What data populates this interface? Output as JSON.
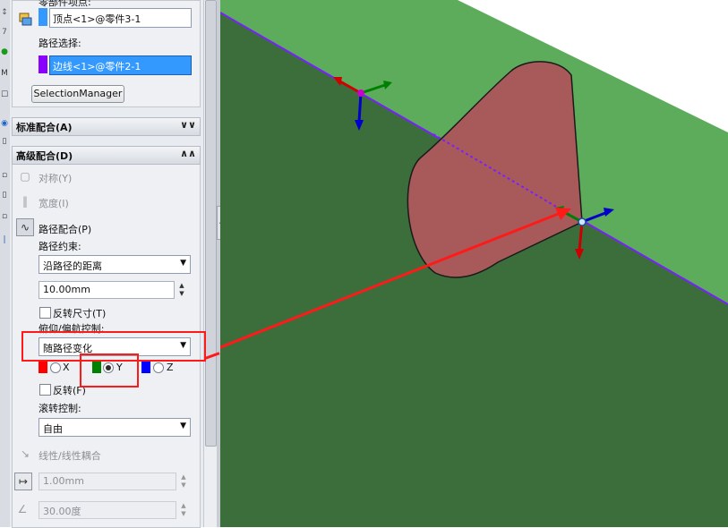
{
  "panel": {
    "top_label_partial": "零部件项点:",
    "component_value": "顶点<1>@零件3-1",
    "path_label": "路径选择:",
    "path_value": "边线<1>@零件2-1",
    "selection_manager": "SelectionManager",
    "standard_mates": "标准配合(A)",
    "advanced_mates": "高级配合(D)",
    "mates": {
      "symmetric": "对称(Y)",
      "width": "宽度(I)",
      "path_mate": "路径配合(P)"
    },
    "path_constraint_label": "路径约束:",
    "path_constraint_value": "沿路径的距离",
    "distance_value": "10.00mm",
    "flip_dimension": "反转尺寸(T)",
    "pitch_yaw_label": "俯仰/偏航控制:",
    "pitch_yaw_value": "随路径变化",
    "axes": {
      "x": "X",
      "y": "Y",
      "z": "Z",
      "selected": "Y"
    },
    "flip": "反转(F)",
    "roll_label": "滚转控制:",
    "roll_value": "自由",
    "linear_coupler": "线性/线性耦合",
    "linear_value": "1.00mm",
    "angle_value": "30.00度"
  },
  "colors": {
    "x_axis": "#ff0000",
    "y_axis": "#008000",
    "z_axis": "#0000ff",
    "path_swatch": "#8a00ff",
    "component_swatch": "#3399ff",
    "plane_light": "#5cac5c",
    "plane_dark": "#3b6e3b",
    "cone": "#a85a5a",
    "edge_line": "#7a1fff",
    "annotation": "#ff0000"
  },
  "icons": {
    "component": "component-icon",
    "symmetric": "symmetric-icon",
    "width": "width-icon",
    "path_mate": "path-mate-icon",
    "linear_coupler": "linear-coupler-icon",
    "distance": "distance-icon",
    "angle": "angle-icon"
  }
}
